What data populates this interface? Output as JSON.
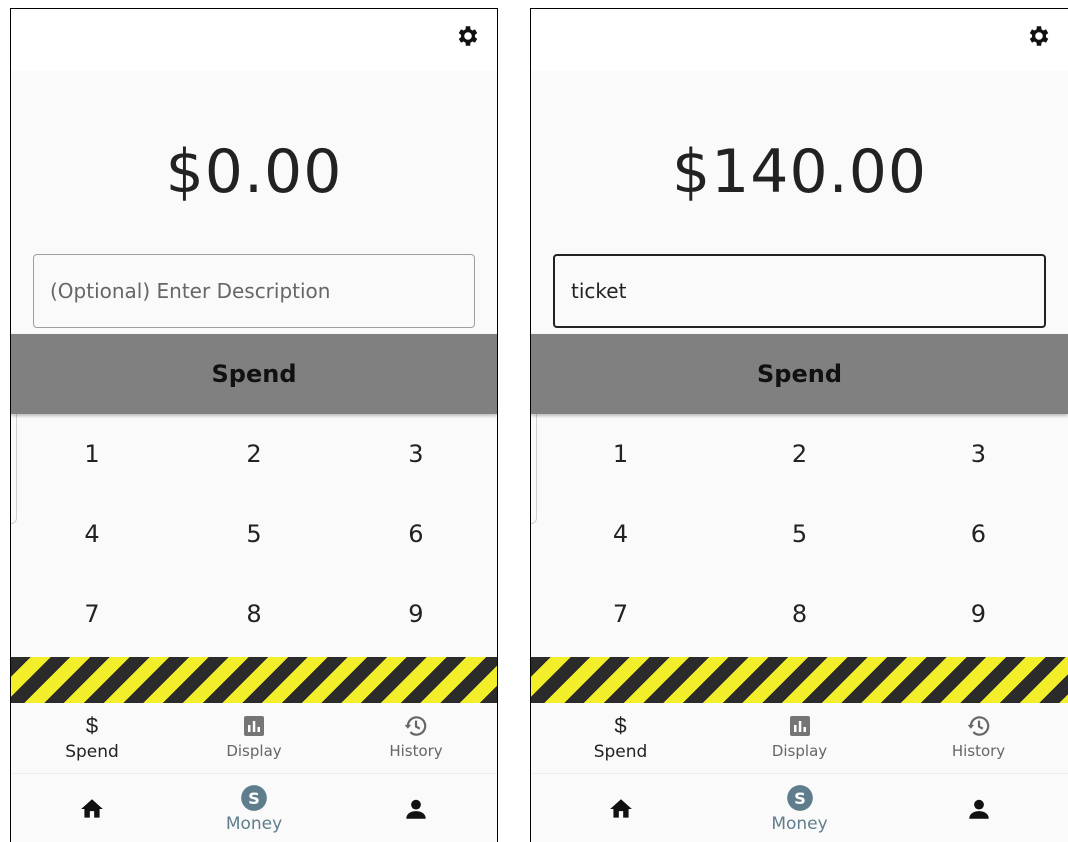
{
  "screens": [
    {
      "amount": "$0.00",
      "description": {
        "value": "",
        "placeholder": "(Optional) Enter Description"
      },
      "spend_label": "Spend",
      "keys": [
        "1",
        "2",
        "3",
        "4",
        "5",
        "6",
        "7",
        "8",
        "9"
      ],
      "subnav": [
        {
          "label": "Spend",
          "icon": "dollar-icon",
          "active": true
        },
        {
          "label": "Display",
          "icon": "bar-chart-icon",
          "active": false
        },
        {
          "label": "History",
          "icon": "history-icon",
          "active": false
        }
      ],
      "bottomnav": {
        "center_label": "Money"
      }
    },
    {
      "amount": "$140.00",
      "description": {
        "value": "ticket",
        "placeholder": "(Optional) Enter Description"
      },
      "spend_label": "Spend",
      "keys": [
        "1",
        "2",
        "3",
        "4",
        "5",
        "6",
        "7",
        "8",
        "9"
      ],
      "subnav": [
        {
          "label": "Spend",
          "icon": "dollar-icon",
          "active": true
        },
        {
          "label": "Display",
          "icon": "bar-chart-icon",
          "active": false
        },
        {
          "label": "History",
          "icon": "history-icon",
          "active": false
        }
      ],
      "bottomnav": {
        "center_label": "Money"
      }
    }
  ],
  "icons": {
    "dollar_glyph": "$",
    "settings": "gear-icon",
    "home": "home-icon",
    "money": "money-icon",
    "profile": "person-icon"
  },
  "colors": {
    "spend_button": "#808080",
    "money_accent": "#5f7d8c",
    "hazard_dark": "#2b2b2b",
    "hazard_yellow": "#f2ee2a"
  }
}
